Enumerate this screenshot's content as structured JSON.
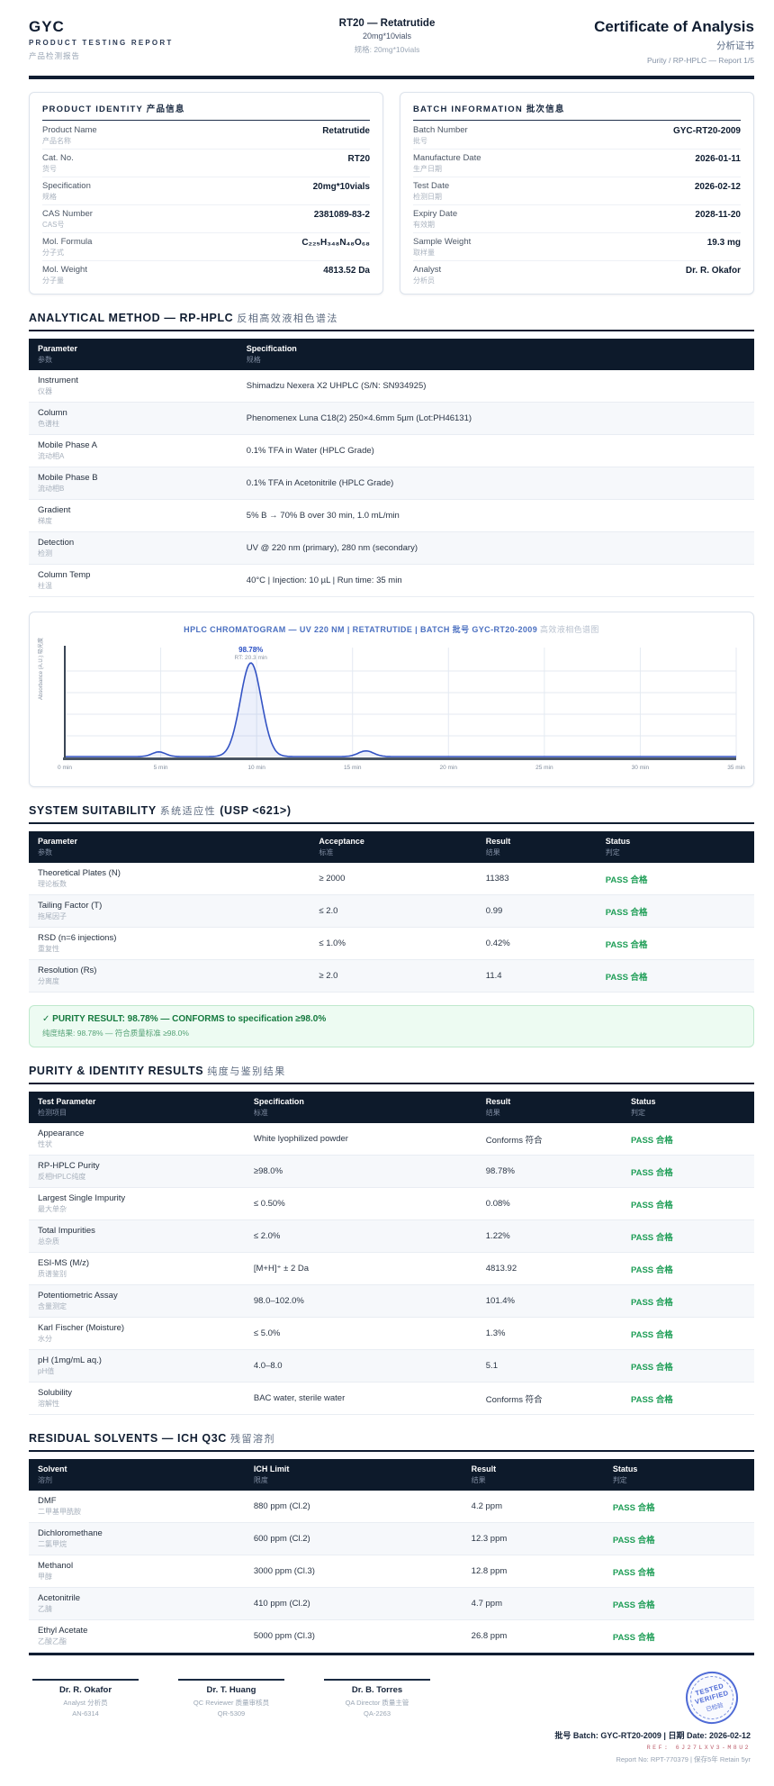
{
  "header": {
    "brand": "GYC",
    "report_line": "PRODUCT TESTING REPORT",
    "report_line_cn": "产品检测报告",
    "product_title": "RT20 — Retatrutide",
    "product_spec": "20mg*10vials",
    "product_spec_cn": "规格: 20mg*10vials",
    "doc_title": "Certificate of Analysis",
    "doc_title_cn": "分析证书",
    "doc_subtitle": "Purity / RP-HPLC — Report 1/5"
  },
  "product_identity": {
    "title": "PRODUCT IDENTITY 产品信息",
    "rows": [
      {
        "label": "Product Name",
        "label_cn": "产品名称",
        "value": "Retatrutide"
      },
      {
        "label": "Cat. No.",
        "label_cn": "货号",
        "value": "RT20"
      },
      {
        "label": "Specification",
        "label_cn": "规格",
        "value": "20mg*10vials"
      },
      {
        "label": "CAS Number",
        "label_cn": "CAS号",
        "value": "2381089-83-2"
      },
      {
        "label": "Mol. Formula",
        "label_cn": "分子式",
        "value": "C₂₂₅H₃₄₈N₄₈O₆₈"
      },
      {
        "label": "Mol. Weight",
        "label_cn": "分子量",
        "value": "4813.52 Da"
      }
    ]
  },
  "batch_information": {
    "title": "BATCH INFORMATION 批次信息",
    "rows": [
      {
        "label": "Batch Number",
        "label_cn": "批号",
        "value": "GYC-RT20-2009"
      },
      {
        "label": "Manufacture Date",
        "label_cn": "生产日期",
        "value": "2026-01-11"
      },
      {
        "label": "Test Date",
        "label_cn": "检测日期",
        "value": "2026-02-12"
      },
      {
        "label": "Expiry Date",
        "label_cn": "有效期",
        "value": "2028-11-20"
      },
      {
        "label": "Sample Weight",
        "label_cn": "取样量",
        "value": "19.3 mg"
      },
      {
        "label": "Analyst",
        "label_cn": "分析员",
        "value": "Dr. R. Okafor"
      }
    ]
  },
  "analytical_method": {
    "heading_en": "ANALYTICAL METHOD — RP-HPLC",
    "heading_cn": "反相高效液相色谱法",
    "columns": [
      {
        "en": "Parameter",
        "cn": "参数"
      },
      {
        "en": "Specification",
        "cn": "规格"
      }
    ],
    "rows": [
      {
        "p": "Instrument",
        "p_cn": "仪器",
        "spec": "Shimadzu Nexera X2 UHPLC (S/N: SN934925)"
      },
      {
        "p": "Column",
        "p_cn": "色谱柱",
        "spec": "Phenomenex Luna C18(2) 250×4.6mm 5µm (Lot:PH46131)"
      },
      {
        "p": "Mobile Phase A",
        "p_cn": "流动相A",
        "spec": "0.1% TFA in Water (HPLC Grade)"
      },
      {
        "p": "Mobile Phase B",
        "p_cn": "流动相B",
        "spec": "0.1% TFA in Acetonitrile (HPLC Grade)"
      },
      {
        "p": "Gradient",
        "p_cn": "梯度",
        "spec": "5% B → 70% B over 30 min, 1.0 mL/min"
      },
      {
        "p": "Detection",
        "p_cn": "检测",
        "spec": "UV @ 220 nm (primary), 280 nm (secondary)"
      },
      {
        "p": "Column Temp",
        "p_cn": "柱温",
        "spec": "40°C | Injection: 10 µL | Run time: 35 min"
      }
    ]
  },
  "chromatogram": {
    "title_en": "HPLC CHROMATOGRAM — UV 220 NM | RETATRUTIDE | BATCH 批号 GYC-RT20-2009",
    "title_cn": "高效液相色谱图",
    "peak_percent_label": "98.78%",
    "peak_rt_label": "RT: 20.3 min",
    "y_axis_label": "Absorbance (A.U.) 吸光度",
    "chart_data": {
      "type": "line",
      "title": "HPLC CHROMATOGRAM — UV 220 NM | RETATRUTIDE | BATCH GYC-RT20-2009",
      "x_label": "time (min)",
      "y_label": "Absorbance (A.U.)",
      "x_range": [
        0,
        35
      ],
      "x_ticks": [
        0,
        5,
        10,
        15,
        20,
        25,
        30,
        35
      ],
      "x_tick_labels": [
        "0 min",
        "5 min",
        "10 min",
        "15 min",
        "20 min",
        "25 min",
        "30 min",
        "35 min"
      ],
      "grid": true,
      "main_peak": {
        "area_percent": 98.78,
        "rt_label_min": 20.3
      },
      "peaks": [
        {
          "rt_min": 9.7,
          "rel_height": 1.0,
          "sigma_min": 0.55
        },
        {
          "rt_min": 4.9,
          "rel_height": 0.05,
          "sigma_min": 0.35
        },
        {
          "rt_min": 15.7,
          "rel_height": 0.06,
          "sigma_min": 0.4
        }
      ]
    }
  },
  "system_suitability": {
    "heading_en": "SYSTEM SUITABILITY",
    "heading_cn": "系统适应性",
    "heading_suffix": "(USP <621>)",
    "columns": [
      {
        "en": "Parameter",
        "cn": "参数"
      },
      {
        "en": "Acceptance",
        "cn": "标准"
      },
      {
        "en": "Result",
        "cn": "结果"
      },
      {
        "en": "Status",
        "cn": "判定"
      }
    ],
    "rows": [
      {
        "p": "Theoretical Plates (N)",
        "p_cn": "理论板数",
        "a": "≥ 2000",
        "r": "11383",
        "s": "PASS 合格"
      },
      {
        "p": "Tailing Factor (T)",
        "p_cn": "拖尾因子",
        "a": "≤ 2.0",
        "r": "0.99",
        "s": "PASS 合格"
      },
      {
        "p": "RSD (n=6 injections)",
        "p_cn": "重复性",
        "a": "≤ 1.0%",
        "r": "0.42%",
        "s": "PASS 合格"
      },
      {
        "p": "Resolution (Rs)",
        "p_cn": "分离度",
        "a": "≥ 2.0",
        "r": "11.4",
        "s": "PASS 合格"
      }
    ]
  },
  "purity_banner": {
    "line1": "✓ PURITY RESULT: 98.78% — CONFORMS to specification ≥98.0%",
    "line2": "纯度结果: 98.78% — 符合质量标准 ≥98.0%"
  },
  "purity_results": {
    "heading_en": "PURITY & IDENTITY RESULTS",
    "heading_cn": "纯度与鉴别结果",
    "columns": [
      {
        "en": "Test Parameter",
        "cn": "检测项目"
      },
      {
        "en": "Specification",
        "cn": "标准"
      },
      {
        "en": "Result",
        "cn": "结果"
      },
      {
        "en": "Status",
        "cn": "判定"
      }
    ],
    "rows": [
      {
        "p": "Appearance",
        "p_cn": "性状",
        "a": "White lyophilized powder",
        "r": "Conforms 符合",
        "s": "PASS 合格"
      },
      {
        "p": "RP-HPLC Purity",
        "p_cn": "反相HPLC纯度",
        "a": "≥98.0%",
        "r": "98.78%",
        "s": "PASS 合格"
      },
      {
        "p": "Largest Single Impurity",
        "p_cn": "最大单杂",
        "a": "≤ 0.50%",
        "r": "0.08%",
        "s": "PASS 合格"
      },
      {
        "p": "Total Impurities",
        "p_cn": "总杂质",
        "a": "≤ 2.0%",
        "r": "1.22%",
        "s": "PASS 合格"
      },
      {
        "p": "ESI-MS (M/z)",
        "p_cn": "质谱鉴别",
        "a": "[M+H]⁺ ± 2 Da",
        "r": "4813.92",
        "s": "PASS 合格"
      },
      {
        "p": "Potentiometric Assay",
        "p_cn": "含量测定",
        "a": "98.0–102.0%",
        "r": "101.4%",
        "s": "PASS 合格"
      },
      {
        "p": "Karl Fischer (Moisture)",
        "p_cn": "水分",
        "a": "≤ 5.0%",
        "r": "1.3%",
        "s": "PASS 合格"
      },
      {
        "p": "pH (1mg/mL aq.)",
        "p_cn": "pH值",
        "a": "4.0–8.0",
        "r": "5.1",
        "s": "PASS 合格"
      },
      {
        "p": "Solubility",
        "p_cn": "溶解性",
        "a": "BAC water, sterile water",
        "r": "Conforms 符合",
        "s": "PASS 合格"
      }
    ]
  },
  "residual_solvents": {
    "heading_en": "RESIDUAL SOLVENTS — ICH Q3C",
    "heading_cn": "残留溶剂",
    "columns": [
      {
        "en": "Solvent",
        "cn": "溶剂"
      },
      {
        "en": "ICH Limit",
        "cn": "限度"
      },
      {
        "en": "Result",
        "cn": "结果"
      },
      {
        "en": "Status",
        "cn": "判定"
      }
    ],
    "rows": [
      {
        "p": "DMF",
        "p_cn": "二甲基甲酰胺",
        "a": "880 ppm (Cl.2)",
        "r": "4.2 ppm",
        "s": "PASS 合格"
      },
      {
        "p": "Dichloromethane",
        "p_cn": "二氯甲烷",
        "a": "600 ppm (Cl.2)",
        "r": "12.3 ppm",
        "s": "PASS 合格"
      },
      {
        "p": "Methanol",
        "p_cn": "甲醇",
        "a": "3000 ppm (Cl.3)",
        "r": "12.8 ppm",
        "s": "PASS 合格"
      },
      {
        "p": "Acetonitrile",
        "p_cn": "乙腈",
        "a": "410 ppm (Cl.2)",
        "r": "4.7 ppm",
        "s": "PASS 合格"
      },
      {
        "p": "Ethyl Acetate",
        "p_cn": "乙酸乙酯",
        "a": "5000 ppm (Cl.3)",
        "r": "26.8 ppm",
        "s": "PASS 合格"
      }
    ]
  },
  "footer": {
    "signers": [
      {
        "name": "Dr. R. Okafor",
        "role": "Analyst 分析员",
        "id": "AN-6314"
      },
      {
        "name": "Dr. T. Huang",
        "role": "QC Reviewer 质量审核员",
        "id": "QR-5309"
      },
      {
        "name": "Dr. B. Torres",
        "role": "QA Director 质量主管",
        "id": "QA-2263"
      }
    ],
    "stamp": {
      "line1": "TESTED",
      "line2": "VERIFIED",
      "line3": "已检验"
    },
    "batch_line": "批号 Batch: GYC-RT20-2009 | 日期 Date: 2026-02-12",
    "ref_line": "REF: 6J27LXV3-M8U2",
    "report_line": "Report No: RPT-770379 | 保存5年 Retain 5yr"
  }
}
